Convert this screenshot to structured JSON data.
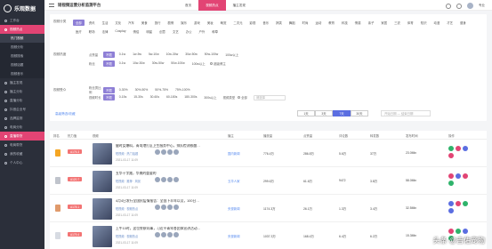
{
  "app": {
    "logo_text": "乐观数据",
    "title": "短视频运营分析监测平台"
  },
  "sidebar": {
    "items": [
      {
        "label": "工作台",
        "icon": "home-icon"
      },
      {
        "label": "视频热点",
        "icon": "video-icon",
        "active": true
      },
      {
        "label": "热门视频",
        "sub": true,
        "active": true
      },
      {
        "label": "视频分析",
        "sub": true
      },
      {
        "label": "视频搜索",
        "sub": true
      },
      {
        "label": "视频话题",
        "sub": true
      },
      {
        "label": "视频音乐",
        "sub": true
      },
      {
        "label": "播主发现",
        "icon": "user-icon"
      },
      {
        "label": "播主分析",
        "icon": "chart-icon"
      },
      {
        "label": "直播分析",
        "icon": "live-icon"
      },
      {
        "label": "抖音企业号",
        "icon": "company-icon"
      },
      {
        "label": "品牌监测",
        "icon": "tag-icon"
      },
      {
        "label": "电商分析",
        "icon": "cart-icon"
      },
      {
        "label": "直播带货",
        "icon": "bag-icon",
        "active2": true
      },
      {
        "label": "电商带货",
        "icon": "shop-icon"
      },
      {
        "label": "我的收藏",
        "icon": "star-icon"
      },
      {
        "label": "个人中心",
        "icon": "person-icon"
      }
    ]
  },
  "topbar": {
    "tabs": [
      {
        "label": "首页"
      },
      {
        "label": "视频热点",
        "active": true
      },
      {
        "label": "播主发现"
      }
    ],
    "user": "专业",
    "icons": [
      "search-icon",
      "bell-icon"
    ]
  },
  "filters": {
    "category": {
      "label": "视频分类",
      "chips": [
        "全部",
        "资讯",
        "生活",
        "文化",
        "汽车",
        "美食",
        "旅行",
        "剧情",
        "娱乐",
        "游戏",
        "美妆",
        "萌宠",
        "二次元",
        "影视",
        "音乐",
        "搞笑",
        "舞蹈",
        "时尚",
        "运动",
        "教育",
        "科技",
        "情感",
        "亲子",
        "家居",
        "三农",
        "体育",
        "知识",
        "动漫",
        "才艺",
        "健身",
        "医疗",
        "职场",
        "法律",
        "Cosplay",
        "情侣",
        "明星",
        "创意",
        "文艺",
        "办公",
        "户外",
        "种草"
      ]
    },
    "hot": {
      "label": "视频热度",
      "sub1": "点赞量",
      "sub1_chips": [
        "不限",
        "0-1w",
        "1w-5w",
        "5w-10w",
        "10w-30w",
        "30w-50w",
        "50w-100w",
        "100w以上"
      ],
      "sub2": "粉丝",
      "sub2_chips": [
        "不限",
        "0-1w",
        "10w-30w",
        "30w-50w",
        "50w-100w",
        "100w以上"
      ],
      "radio": "超级博主"
    },
    "audience": {
      "label": "视频受众",
      "sub1": "粉丝男比例",
      "sub1_chips": [
        "不限",
        "0-30%",
        "30%-50%",
        "50%-75%",
        "75%-100%"
      ],
      "sub2": "视频时长",
      "sub2_chips": [
        "不限",
        "0-15s",
        "15-30s",
        "30-60s",
        "60-180s",
        "180-300s",
        "300s以上"
      ],
      "sub3": "视频类型",
      "radio": "全部",
      "select_placeholder": "请选择"
    },
    "link": "高级筛选/收藏",
    "range_buttons": [
      "1天",
      "3天",
      "7天",
      "30天"
    ],
    "range_active": 2,
    "date_placeholder": "开始日期 — 结束日期"
  },
  "table": {
    "columns": [
      "排名",
      "热力值",
      "视频",
      "播主",
      "播放量",
      "点赞量",
      "评论数",
      "转发数",
      "发布时间",
      "操作"
    ],
    "rows": [
      {
        "rank_num": "A176.3",
        "title": "腿时女爆料，青岛港打区卫生服务中心，排队检测核酸…",
        "meta": "短视频 · 热门话题",
        "date": "2021-03-17 11:09",
        "anchor": "国内新闻",
        "plays": "776.4万",
        "likes": "286.8万",
        "comments": "5.6万",
        "shares": "37万",
        "time": "23.0Min"
      },
      {
        "rank_num": "A120.7",
        "title": "五华十字路，华美的重要的",
        "meta": "短视频 · 推荐 · 风景",
        "date": "2021-03-17 11:09",
        "anchor": "五华人家",
        "plays": "299.6万",
        "likes": "61.6万",
        "comments": "9472",
        "shares": "3.8万",
        "time": "58.0Min"
      },
      {
        "rank_num": "A178.1",
        "title": "4月4日发行全国抗疫情报告：全国下半年以及，100日…",
        "meta": "短视频 · 视频热点",
        "date": "2021-03-17 11:09",
        "anchor": "央视新闻",
        "plays": "1174.3万",
        "likes": "26.1万",
        "comments": "1.3万",
        "shares": "3.4万",
        "time": "32.5Min"
      },
      {
        "rank_num": "A179.4",
        "title": "上午10时，这位警察同事，习近平青年各团体宣讲活动…",
        "meta": "短视频 · 视频热点",
        "date": "2021-03-17 11:09",
        "anchor": "央视新闻",
        "plays": "1037.3万",
        "likes": "168.4万",
        "comments": "6.4万",
        "shares": "6.2万",
        "time": "15.3Min"
      }
    ]
  },
  "watermark": "头条 @吉佑宠物",
  "colors": {
    "accent": "#e24474",
    "primary": "#5b6ee1",
    "chip_active": "#8e7fd6",
    "sidebar_bg": "#2b2f3a"
  }
}
